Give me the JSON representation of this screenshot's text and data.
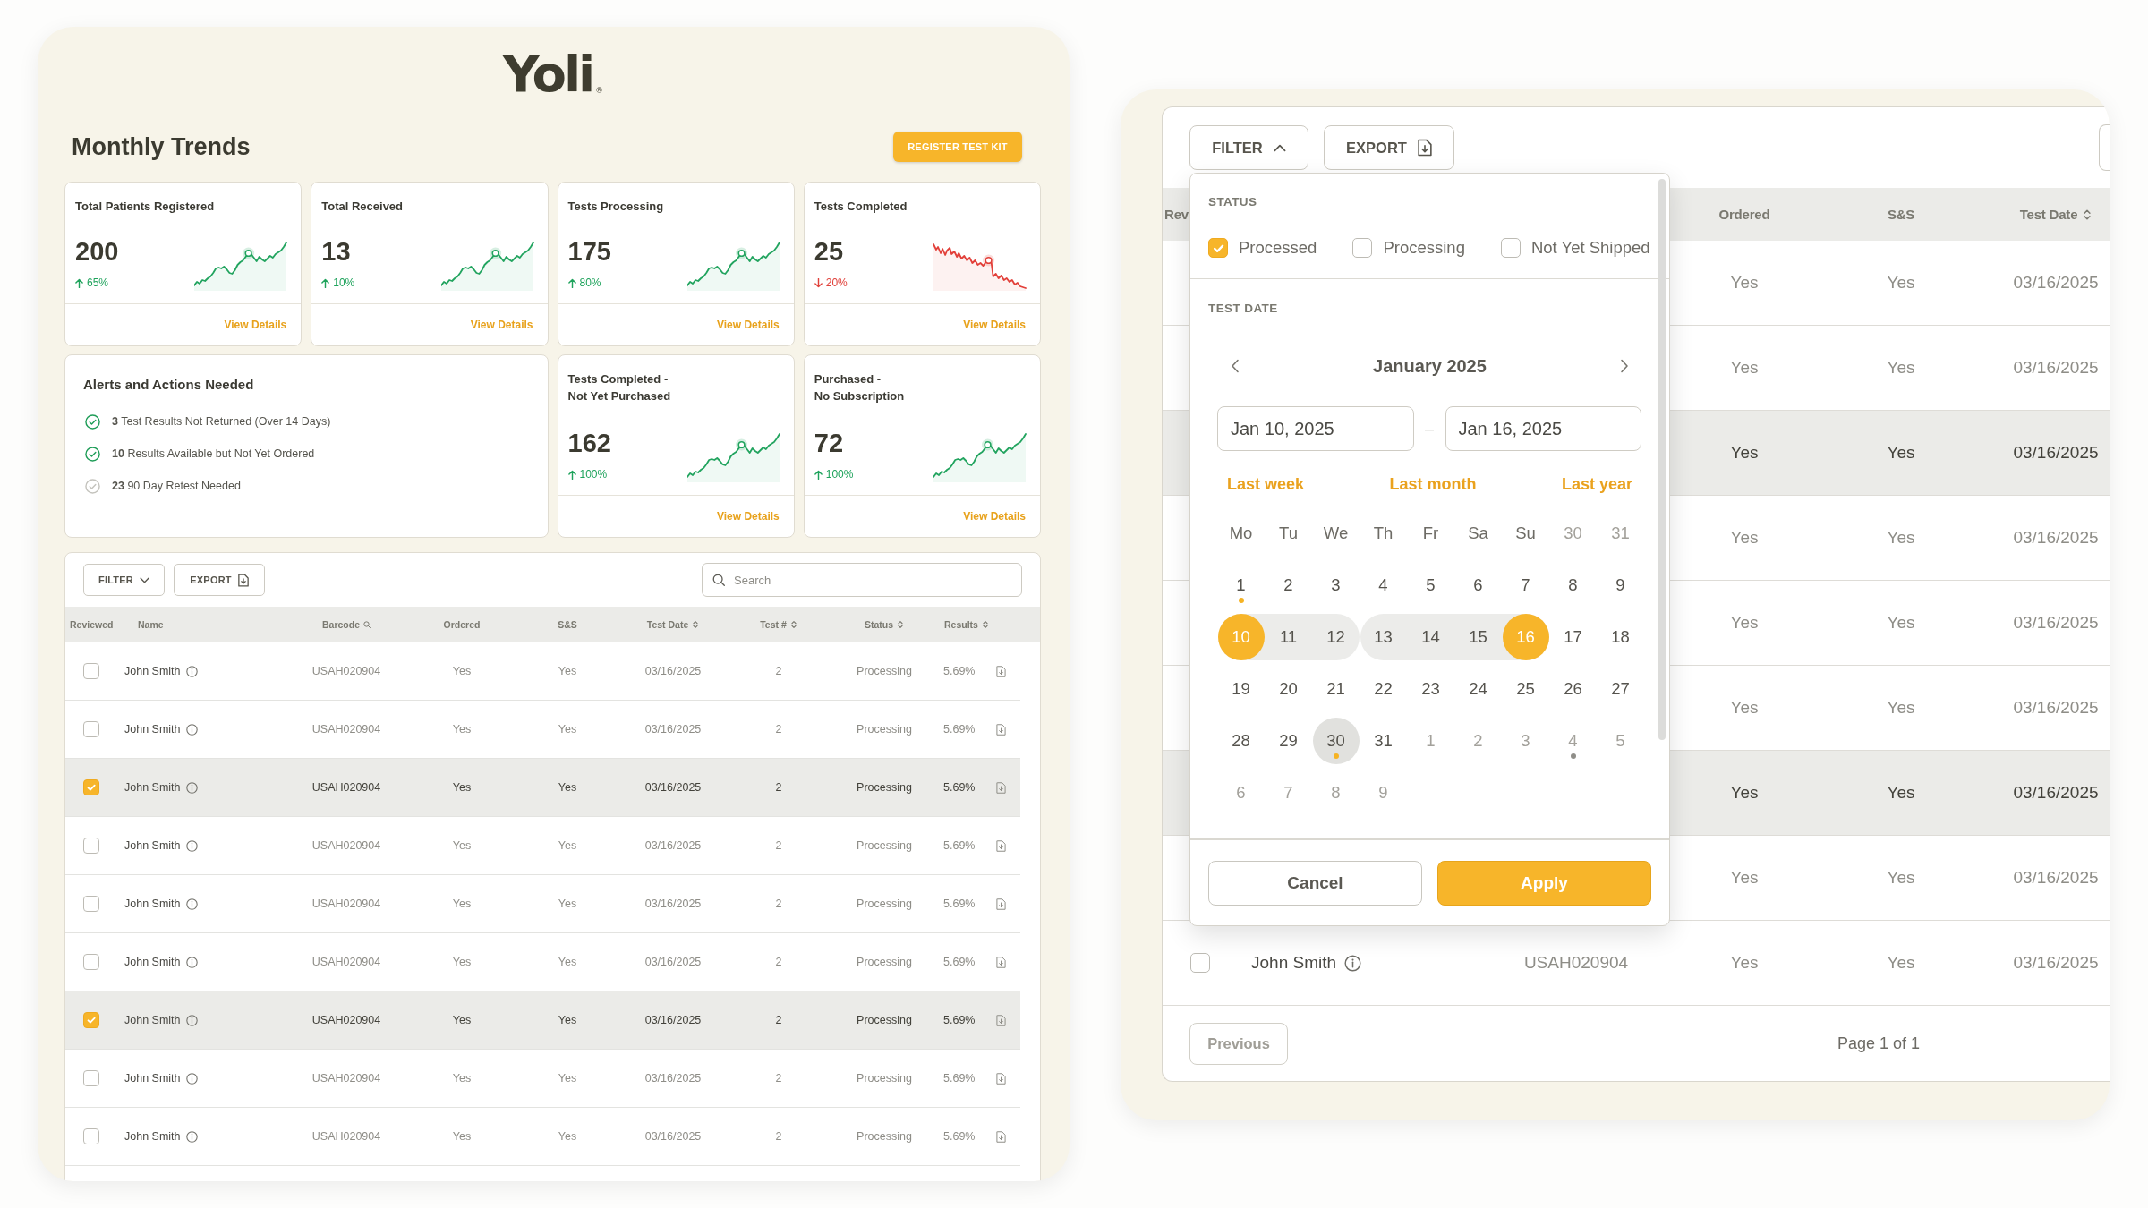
{
  "dashboard": {
    "logo": {
      "name": "Yoli",
      "mark": "®"
    },
    "heading": "Monthly Trends",
    "register_button": "REGISTER TEST KIT",
    "cards": [
      {
        "kind": "stat",
        "title": "Total Patients Registered",
        "value": "200",
        "change": "65%",
        "falling": false,
        "link": "View Details"
      },
      {
        "kind": "stat",
        "title": "Total Received",
        "value": "13",
        "change": "10%",
        "falling": false,
        "link": "View Details"
      },
      {
        "kind": "stat",
        "title": "Tests Processing",
        "value": "175",
        "change": "80%",
        "falling": false,
        "link": "View Details"
      },
      {
        "kind": "stat",
        "title": "Tests Completed",
        "value": "25",
        "change": "20%",
        "falling": true,
        "link": "View Details"
      },
      {
        "kind": "alerts",
        "title": "Alerts and Actions Needed",
        "items": [
          {
            "text": "**3** Test Results Not Returned (Over 14 Days)",
            "checked": true
          },
          {
            "text": "**10** Results Available but Not Yet Ordered",
            "checked": true
          },
          {
            "text": "**23** 90 Day Retest Needed",
            "checked": false
          }
        ]
      },
      {
        "kind": "stat",
        "title": "Tests Completed -\nNot Yet Purchased",
        "value": "162",
        "change": "100%",
        "falling": false,
        "link": "View Details"
      },
      {
        "kind": "stat",
        "title": "Purchased -\nNo Subscription",
        "value": "72",
        "change": "100%",
        "falling": false,
        "link": "View Details"
      }
    ],
    "table": {
      "filter": {
        "label": "FILTER",
        "expanded": false
      },
      "export": "EXPORT",
      "search": {
        "placeholder": "Search"
      },
      "columns": [
        {
          "label": "Reviewed",
          "kind": "plain"
        },
        {
          "label": "Name",
          "kind": "plain"
        },
        {
          "label": "Barcode",
          "kind": "searchable"
        },
        {
          "label": "Ordered",
          "kind": "plain"
        },
        {
          "label": "S&S",
          "kind": "plain"
        },
        {
          "label": "Test Date",
          "kind": "sortable"
        },
        {
          "label": "Test #",
          "kind": "sortable"
        },
        {
          "label": "Status",
          "kind": "sortable"
        },
        {
          "label": "Results",
          "kind": "sortable"
        }
      ],
      "rows": [
        {
          "selected": false,
          "checked": false,
          "name": "John Smith",
          "barcode": "USAH020904",
          "ordered": "Yes",
          "ss": "Yes",
          "test_date": "03/16/2025",
          "test_no": "2",
          "status": "Processing",
          "results": "5.69%"
        },
        {
          "selected": false,
          "checked": false,
          "name": "John Smith",
          "barcode": "USAH020904",
          "ordered": "Yes",
          "ss": "Yes",
          "test_date": "03/16/2025",
          "test_no": "2",
          "status": "Processing",
          "results": "5.69%"
        },
        {
          "selected": true,
          "checked": true,
          "name": "John Smith",
          "barcode": "USAH020904",
          "ordered": "Yes",
          "ss": "Yes",
          "test_date": "03/16/2025",
          "test_no": "2",
          "status": "Processing",
          "results": "5.69%"
        },
        {
          "selected": false,
          "checked": false,
          "name": "John Smith",
          "barcode": "USAH020904",
          "ordered": "Yes",
          "ss": "Yes",
          "test_date": "03/16/2025",
          "test_no": "2",
          "status": "Processing",
          "results": "5.69%"
        },
        {
          "selected": false,
          "checked": false,
          "name": "John Smith",
          "barcode": "USAH020904",
          "ordered": "Yes",
          "ss": "Yes",
          "test_date": "03/16/2025",
          "test_no": "2",
          "status": "Processing",
          "results": "5.69%"
        },
        {
          "selected": false,
          "checked": false,
          "name": "John Smith",
          "barcode": "USAH020904",
          "ordered": "Yes",
          "ss": "Yes",
          "test_date": "03/16/2025",
          "test_no": "2",
          "status": "Processing",
          "results": "5.69%"
        },
        {
          "selected": true,
          "checked": true,
          "name": "John Smith",
          "barcode": "USAH020904",
          "ordered": "Yes",
          "ss": "Yes",
          "test_date": "03/16/2025",
          "test_no": "2",
          "status": "Processing",
          "results": "5.69%"
        },
        {
          "selected": false,
          "checked": false,
          "name": "John Smith",
          "barcode": "USAH020904",
          "ordered": "Yes",
          "ss": "Yes",
          "test_date": "03/16/2025",
          "test_no": "2",
          "status": "Processing",
          "results": "5.69%"
        },
        {
          "selected": false,
          "checked": false,
          "name": "John Smith",
          "barcode": "USAH020904",
          "ordered": "Yes",
          "ss": "Yes",
          "test_date": "03/16/2025",
          "test_no": "2",
          "status": "Processing",
          "results": "5.69%"
        }
      ]
    }
  },
  "results_view": {
    "filter": {
      "label": "FILTER",
      "expanded": true
    },
    "export": "EXPORT",
    "columns": [
      {
        "label": "Rev",
        "kind": "plain"
      },
      {
        "label": "Ordered",
        "kind": "plain"
      },
      {
        "label": "S&S",
        "kind": "plain"
      },
      {
        "label": "Test Date",
        "kind": "sortable"
      }
    ],
    "rows": [
      {
        "selected": false,
        "ordered": "Yes",
        "ss": "Yes",
        "test_date": "03/16/2025"
      },
      {
        "selected": false,
        "ordered": "Yes",
        "ss": "Yes",
        "test_date": "03/16/2025"
      },
      {
        "selected": true,
        "ordered": "Yes",
        "ss": "Yes",
        "test_date": "03/16/2025"
      },
      {
        "selected": false,
        "ordered": "Yes",
        "ss": "Yes",
        "test_date": "03/16/2025"
      },
      {
        "selected": false,
        "ordered": "Yes",
        "ss": "Yes",
        "test_date": "03/16/2025"
      },
      {
        "selected": false,
        "ordered": "Yes",
        "ss": "Yes",
        "test_date": "03/16/2025"
      },
      {
        "selected": true,
        "ordered": "Yes",
        "ss": "Yes",
        "test_date": "03/16/2025"
      },
      {
        "selected": false,
        "ordered": "Yes",
        "ss": "Yes",
        "test_date": "03/16/2025"
      },
      {
        "selected": false,
        "checked": false,
        "name": "John Smith",
        "barcode": "USAH020904",
        "ordered": "Yes",
        "ss": "Yes",
        "test_date": "03/16/2025"
      }
    ],
    "filter_panel": {
      "status": {
        "title": "STATUS",
        "options": [
          {
            "label": "Processed",
            "checked": true
          },
          {
            "label": "Processing",
            "checked": false
          },
          {
            "label": "Not Yet Shipped",
            "checked": false
          }
        ]
      },
      "test_date": {
        "title": "TEST DATE",
        "month": "January 2025",
        "start_date": "Jan 10, 2025",
        "separator": "–",
        "end_date": "Jan 16, 2025",
        "presets": [
          "Last week",
          "Last month",
          "Last year"
        ]
      },
      "calendar": {
        "weekdays": [
          "Mo",
          "Tu",
          "We",
          "Th",
          "Fr",
          "Sa",
          "Su"
        ],
        "days": [
          {
            "label": "30",
            "selected": false,
            "outside": true,
            "highlighted": false
          },
          {
            "label": "31",
            "selected": false,
            "outside": true,
            "highlighted": false
          },
          {
            "label": "1",
            "selected": false,
            "outside": false,
            "highlighted": false,
            "color": "#f6b323"
          },
          {
            "label": "2",
            "selected": false,
            "outside": false,
            "highlighted": false
          },
          {
            "label": "3",
            "selected": false,
            "outside": false,
            "highlighted": false
          },
          {
            "label": "4",
            "selected": false,
            "outside": false,
            "highlighted": false
          },
          {
            "label": "5",
            "selected": false,
            "outside": false,
            "highlighted": false
          },
          {
            "label": "6",
            "selected": false,
            "outside": false,
            "highlighted": false
          },
          {
            "label": "7",
            "selected": false,
            "outside": false,
            "highlighted": false
          },
          {
            "label": "8",
            "selected": false,
            "outside": false,
            "highlighted": false
          },
          {
            "label": "9",
            "selected": false,
            "outside": false,
            "highlighted": false
          },
          {
            "label": "10",
            "selected": true,
            "outside": false,
            "highlighted": false,
            "range": {
              "joins_left": false,
              "joins_right": true
            }
          },
          {
            "label": "11",
            "selected": false,
            "outside": false,
            "highlighted": false,
            "range": {
              "joins_left": true,
              "joins_right": true
            }
          },
          {
            "label": "12",
            "selected": false,
            "outside": false,
            "highlighted": false,
            "range": {
              "joins_left": true,
              "joins_right": false
            }
          },
          {
            "label": "13",
            "selected": false,
            "outside": false,
            "highlighted": false,
            "range": {
              "joins_left": false,
              "joins_right": true
            }
          },
          {
            "label": "14",
            "selected": false,
            "outside": false,
            "highlighted": false,
            "range": {
              "joins_left": true,
              "joins_right": true
            }
          },
          {
            "label": "15",
            "selected": false,
            "outside": false,
            "highlighted": false,
            "range": {
              "joins_left": true,
              "joins_right": true
            }
          },
          {
            "label": "16",
            "selected": true,
            "outside": false,
            "highlighted": false,
            "range": {
              "joins_left": true,
              "joins_right": false
            }
          },
          {
            "label": "17",
            "selected": false,
            "outside": false,
            "highlighted": false
          },
          {
            "label": "18",
            "selected": false,
            "outside": false,
            "highlighted": false
          },
          {
            "label": "19",
            "selected": false,
            "outside": false,
            "highlighted": false
          },
          {
            "label": "20",
            "selected": false,
            "outside": false,
            "highlighted": false
          },
          {
            "label": "21",
            "selected": false,
            "outside": false,
            "highlighted": false
          },
          {
            "label": "22",
            "selected": false,
            "outside": false,
            "highlighted": false
          },
          {
            "label": "23",
            "selected": false,
            "outside": false,
            "highlighted": false
          },
          {
            "label": "24",
            "selected": false,
            "outside": false,
            "highlighted": false
          },
          {
            "label": "25",
            "selected": false,
            "outside": false,
            "highlighted": false
          },
          {
            "label": "26",
            "selected": false,
            "outside": false,
            "highlighted": false
          },
          {
            "label": "27",
            "selected": false,
            "outside": false,
            "highlighted": false
          },
          {
            "label": "28",
            "selected": false,
            "outside": false,
            "highlighted": false
          },
          {
            "label": "29",
            "selected": false,
            "outside": false,
            "highlighted": false
          },
          {
            "label": "30",
            "selected": false,
            "outside": false,
            "highlighted": true,
            "color": "#f6b323"
          },
          {
            "label": "31",
            "selected": false,
            "outside": false,
            "highlighted": false
          },
          {
            "label": "1",
            "selected": false,
            "outside": true,
            "highlighted": false
          },
          {
            "label": "2",
            "selected": false,
            "outside": true,
            "highlighted": false
          },
          {
            "label": "3",
            "selected": false,
            "outside": true,
            "highlighted": false
          },
          {
            "label": "4",
            "selected": false,
            "outside": true,
            "highlighted": false,
            "color": "#8f8e89"
          },
          {
            "label": "5",
            "selected": false,
            "outside": true,
            "highlighted": false
          },
          {
            "label": "6",
            "selected": false,
            "outside": true,
            "highlighted": false
          },
          {
            "label": "7",
            "selected": false,
            "outside": true,
            "highlighted": false
          },
          {
            "label": "8",
            "selected": false,
            "outside": true,
            "highlighted": false
          },
          {
            "label": "9",
            "selected": false,
            "outside": true,
            "highlighted": false
          }
        ]
      },
      "cancel": "Cancel",
      "apply": "Apply"
    },
    "pagination": {
      "previous": {
        "label": "Previous",
        "disabled": true
      },
      "page": "Page 1 of 1"
    }
  }
}
